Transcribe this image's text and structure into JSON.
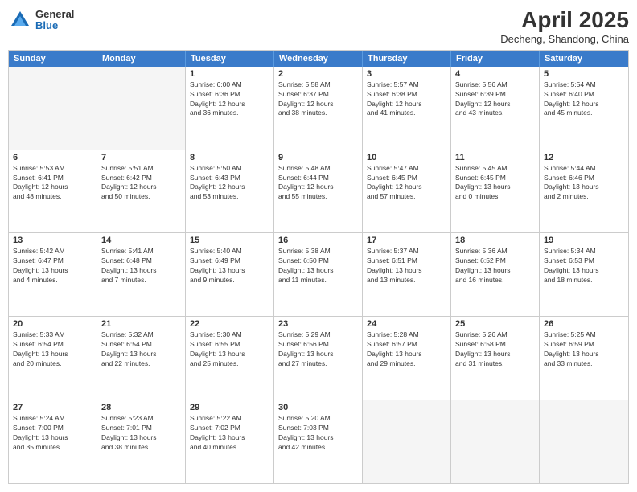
{
  "logo": {
    "general": "General",
    "blue": "Blue"
  },
  "header": {
    "month": "April 2025",
    "location": "Decheng, Shandong, China"
  },
  "weekdays": [
    "Sunday",
    "Monday",
    "Tuesday",
    "Wednesday",
    "Thursday",
    "Friday",
    "Saturday"
  ],
  "weeks": [
    [
      {
        "day": "",
        "empty": true,
        "lines": []
      },
      {
        "day": "",
        "empty": true,
        "lines": []
      },
      {
        "day": "1",
        "empty": false,
        "lines": [
          "Sunrise: 6:00 AM",
          "Sunset: 6:36 PM",
          "Daylight: 12 hours",
          "and 36 minutes."
        ]
      },
      {
        "day": "2",
        "empty": false,
        "lines": [
          "Sunrise: 5:58 AM",
          "Sunset: 6:37 PM",
          "Daylight: 12 hours",
          "and 38 minutes."
        ]
      },
      {
        "day": "3",
        "empty": false,
        "lines": [
          "Sunrise: 5:57 AM",
          "Sunset: 6:38 PM",
          "Daylight: 12 hours",
          "and 41 minutes."
        ]
      },
      {
        "day": "4",
        "empty": false,
        "lines": [
          "Sunrise: 5:56 AM",
          "Sunset: 6:39 PM",
          "Daylight: 12 hours",
          "and 43 minutes."
        ]
      },
      {
        "day": "5",
        "empty": false,
        "lines": [
          "Sunrise: 5:54 AM",
          "Sunset: 6:40 PM",
          "Daylight: 12 hours",
          "and 45 minutes."
        ]
      }
    ],
    [
      {
        "day": "6",
        "empty": false,
        "lines": [
          "Sunrise: 5:53 AM",
          "Sunset: 6:41 PM",
          "Daylight: 12 hours",
          "and 48 minutes."
        ]
      },
      {
        "day": "7",
        "empty": false,
        "lines": [
          "Sunrise: 5:51 AM",
          "Sunset: 6:42 PM",
          "Daylight: 12 hours",
          "and 50 minutes."
        ]
      },
      {
        "day": "8",
        "empty": false,
        "lines": [
          "Sunrise: 5:50 AM",
          "Sunset: 6:43 PM",
          "Daylight: 12 hours",
          "and 53 minutes."
        ]
      },
      {
        "day": "9",
        "empty": false,
        "lines": [
          "Sunrise: 5:48 AM",
          "Sunset: 6:44 PM",
          "Daylight: 12 hours",
          "and 55 minutes."
        ]
      },
      {
        "day": "10",
        "empty": false,
        "lines": [
          "Sunrise: 5:47 AM",
          "Sunset: 6:45 PM",
          "Daylight: 12 hours",
          "and 57 minutes."
        ]
      },
      {
        "day": "11",
        "empty": false,
        "lines": [
          "Sunrise: 5:45 AM",
          "Sunset: 6:45 PM",
          "Daylight: 13 hours",
          "and 0 minutes."
        ]
      },
      {
        "day": "12",
        "empty": false,
        "lines": [
          "Sunrise: 5:44 AM",
          "Sunset: 6:46 PM",
          "Daylight: 13 hours",
          "and 2 minutes."
        ]
      }
    ],
    [
      {
        "day": "13",
        "empty": false,
        "lines": [
          "Sunrise: 5:42 AM",
          "Sunset: 6:47 PM",
          "Daylight: 13 hours",
          "and 4 minutes."
        ]
      },
      {
        "day": "14",
        "empty": false,
        "lines": [
          "Sunrise: 5:41 AM",
          "Sunset: 6:48 PM",
          "Daylight: 13 hours",
          "and 7 minutes."
        ]
      },
      {
        "day": "15",
        "empty": false,
        "lines": [
          "Sunrise: 5:40 AM",
          "Sunset: 6:49 PM",
          "Daylight: 13 hours",
          "and 9 minutes."
        ]
      },
      {
        "day": "16",
        "empty": false,
        "lines": [
          "Sunrise: 5:38 AM",
          "Sunset: 6:50 PM",
          "Daylight: 13 hours",
          "and 11 minutes."
        ]
      },
      {
        "day": "17",
        "empty": false,
        "lines": [
          "Sunrise: 5:37 AM",
          "Sunset: 6:51 PM",
          "Daylight: 13 hours",
          "and 13 minutes."
        ]
      },
      {
        "day": "18",
        "empty": false,
        "lines": [
          "Sunrise: 5:36 AM",
          "Sunset: 6:52 PM",
          "Daylight: 13 hours",
          "and 16 minutes."
        ]
      },
      {
        "day": "19",
        "empty": false,
        "lines": [
          "Sunrise: 5:34 AM",
          "Sunset: 6:53 PM",
          "Daylight: 13 hours",
          "and 18 minutes."
        ]
      }
    ],
    [
      {
        "day": "20",
        "empty": false,
        "lines": [
          "Sunrise: 5:33 AM",
          "Sunset: 6:54 PM",
          "Daylight: 13 hours",
          "and 20 minutes."
        ]
      },
      {
        "day": "21",
        "empty": false,
        "lines": [
          "Sunrise: 5:32 AM",
          "Sunset: 6:54 PM",
          "Daylight: 13 hours",
          "and 22 minutes."
        ]
      },
      {
        "day": "22",
        "empty": false,
        "lines": [
          "Sunrise: 5:30 AM",
          "Sunset: 6:55 PM",
          "Daylight: 13 hours",
          "and 25 minutes."
        ]
      },
      {
        "day": "23",
        "empty": false,
        "lines": [
          "Sunrise: 5:29 AM",
          "Sunset: 6:56 PM",
          "Daylight: 13 hours",
          "and 27 minutes."
        ]
      },
      {
        "day": "24",
        "empty": false,
        "lines": [
          "Sunrise: 5:28 AM",
          "Sunset: 6:57 PM",
          "Daylight: 13 hours",
          "and 29 minutes."
        ]
      },
      {
        "day": "25",
        "empty": false,
        "lines": [
          "Sunrise: 5:26 AM",
          "Sunset: 6:58 PM",
          "Daylight: 13 hours",
          "and 31 minutes."
        ]
      },
      {
        "day": "26",
        "empty": false,
        "lines": [
          "Sunrise: 5:25 AM",
          "Sunset: 6:59 PM",
          "Daylight: 13 hours",
          "and 33 minutes."
        ]
      }
    ],
    [
      {
        "day": "27",
        "empty": false,
        "lines": [
          "Sunrise: 5:24 AM",
          "Sunset: 7:00 PM",
          "Daylight: 13 hours",
          "and 35 minutes."
        ]
      },
      {
        "day": "28",
        "empty": false,
        "lines": [
          "Sunrise: 5:23 AM",
          "Sunset: 7:01 PM",
          "Daylight: 13 hours",
          "and 38 minutes."
        ]
      },
      {
        "day": "29",
        "empty": false,
        "lines": [
          "Sunrise: 5:22 AM",
          "Sunset: 7:02 PM",
          "Daylight: 13 hours",
          "and 40 minutes."
        ]
      },
      {
        "day": "30",
        "empty": false,
        "lines": [
          "Sunrise: 5:20 AM",
          "Sunset: 7:03 PM",
          "Daylight: 13 hours",
          "and 42 minutes."
        ]
      },
      {
        "day": "",
        "empty": true,
        "lines": []
      },
      {
        "day": "",
        "empty": true,
        "lines": []
      },
      {
        "day": "",
        "empty": true,
        "lines": []
      }
    ]
  ]
}
